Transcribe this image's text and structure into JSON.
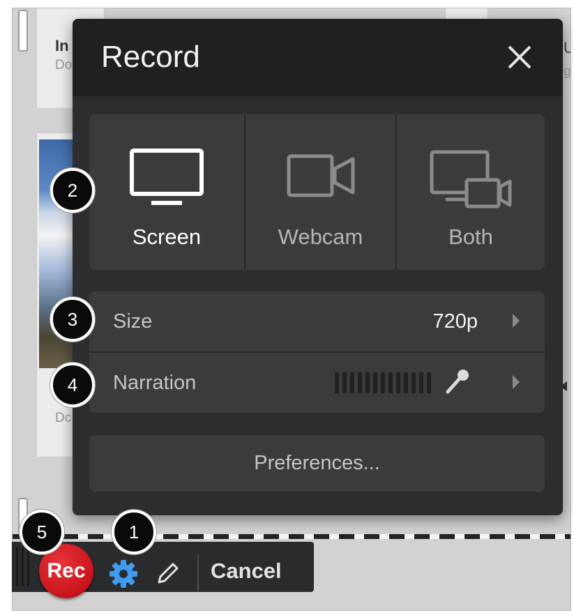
{
  "background": {
    "card_top": {
      "title": "In",
      "subtitle": "Do"
    },
    "card_bottom": {
      "title": "I",
      "subtitle": "Dc"
    },
    "edge_letters": [
      "U",
      "g"
    ]
  },
  "dialog": {
    "title": "Record",
    "modes": [
      {
        "label": "Screen",
        "icon": "monitor-icon",
        "selected": true
      },
      {
        "label": "Webcam",
        "icon": "camera-icon",
        "selected": false
      },
      {
        "label": "Both",
        "icon": "screen-and-camera-icon",
        "selected": false
      }
    ],
    "size": {
      "label": "Size",
      "value": "720p"
    },
    "narration": {
      "label": "Narration",
      "level_bars": 13,
      "icon": "microphone-icon"
    },
    "preferences_label": "Preferences..."
  },
  "toolbar": {
    "rec_label": "Rec",
    "cancel_label": "Cancel",
    "icons": [
      "settings-gear-icon",
      "pencil-icon"
    ]
  },
  "callouts": [
    "1",
    "2",
    "3",
    "4",
    "5"
  ],
  "colors": {
    "panel_bg": "#2c2d2f",
    "panel_header": "#1f2022",
    "button_bg": "#3a3b3e",
    "rec_red": "#d0161d",
    "gear_blue": "#3f9cf0"
  }
}
